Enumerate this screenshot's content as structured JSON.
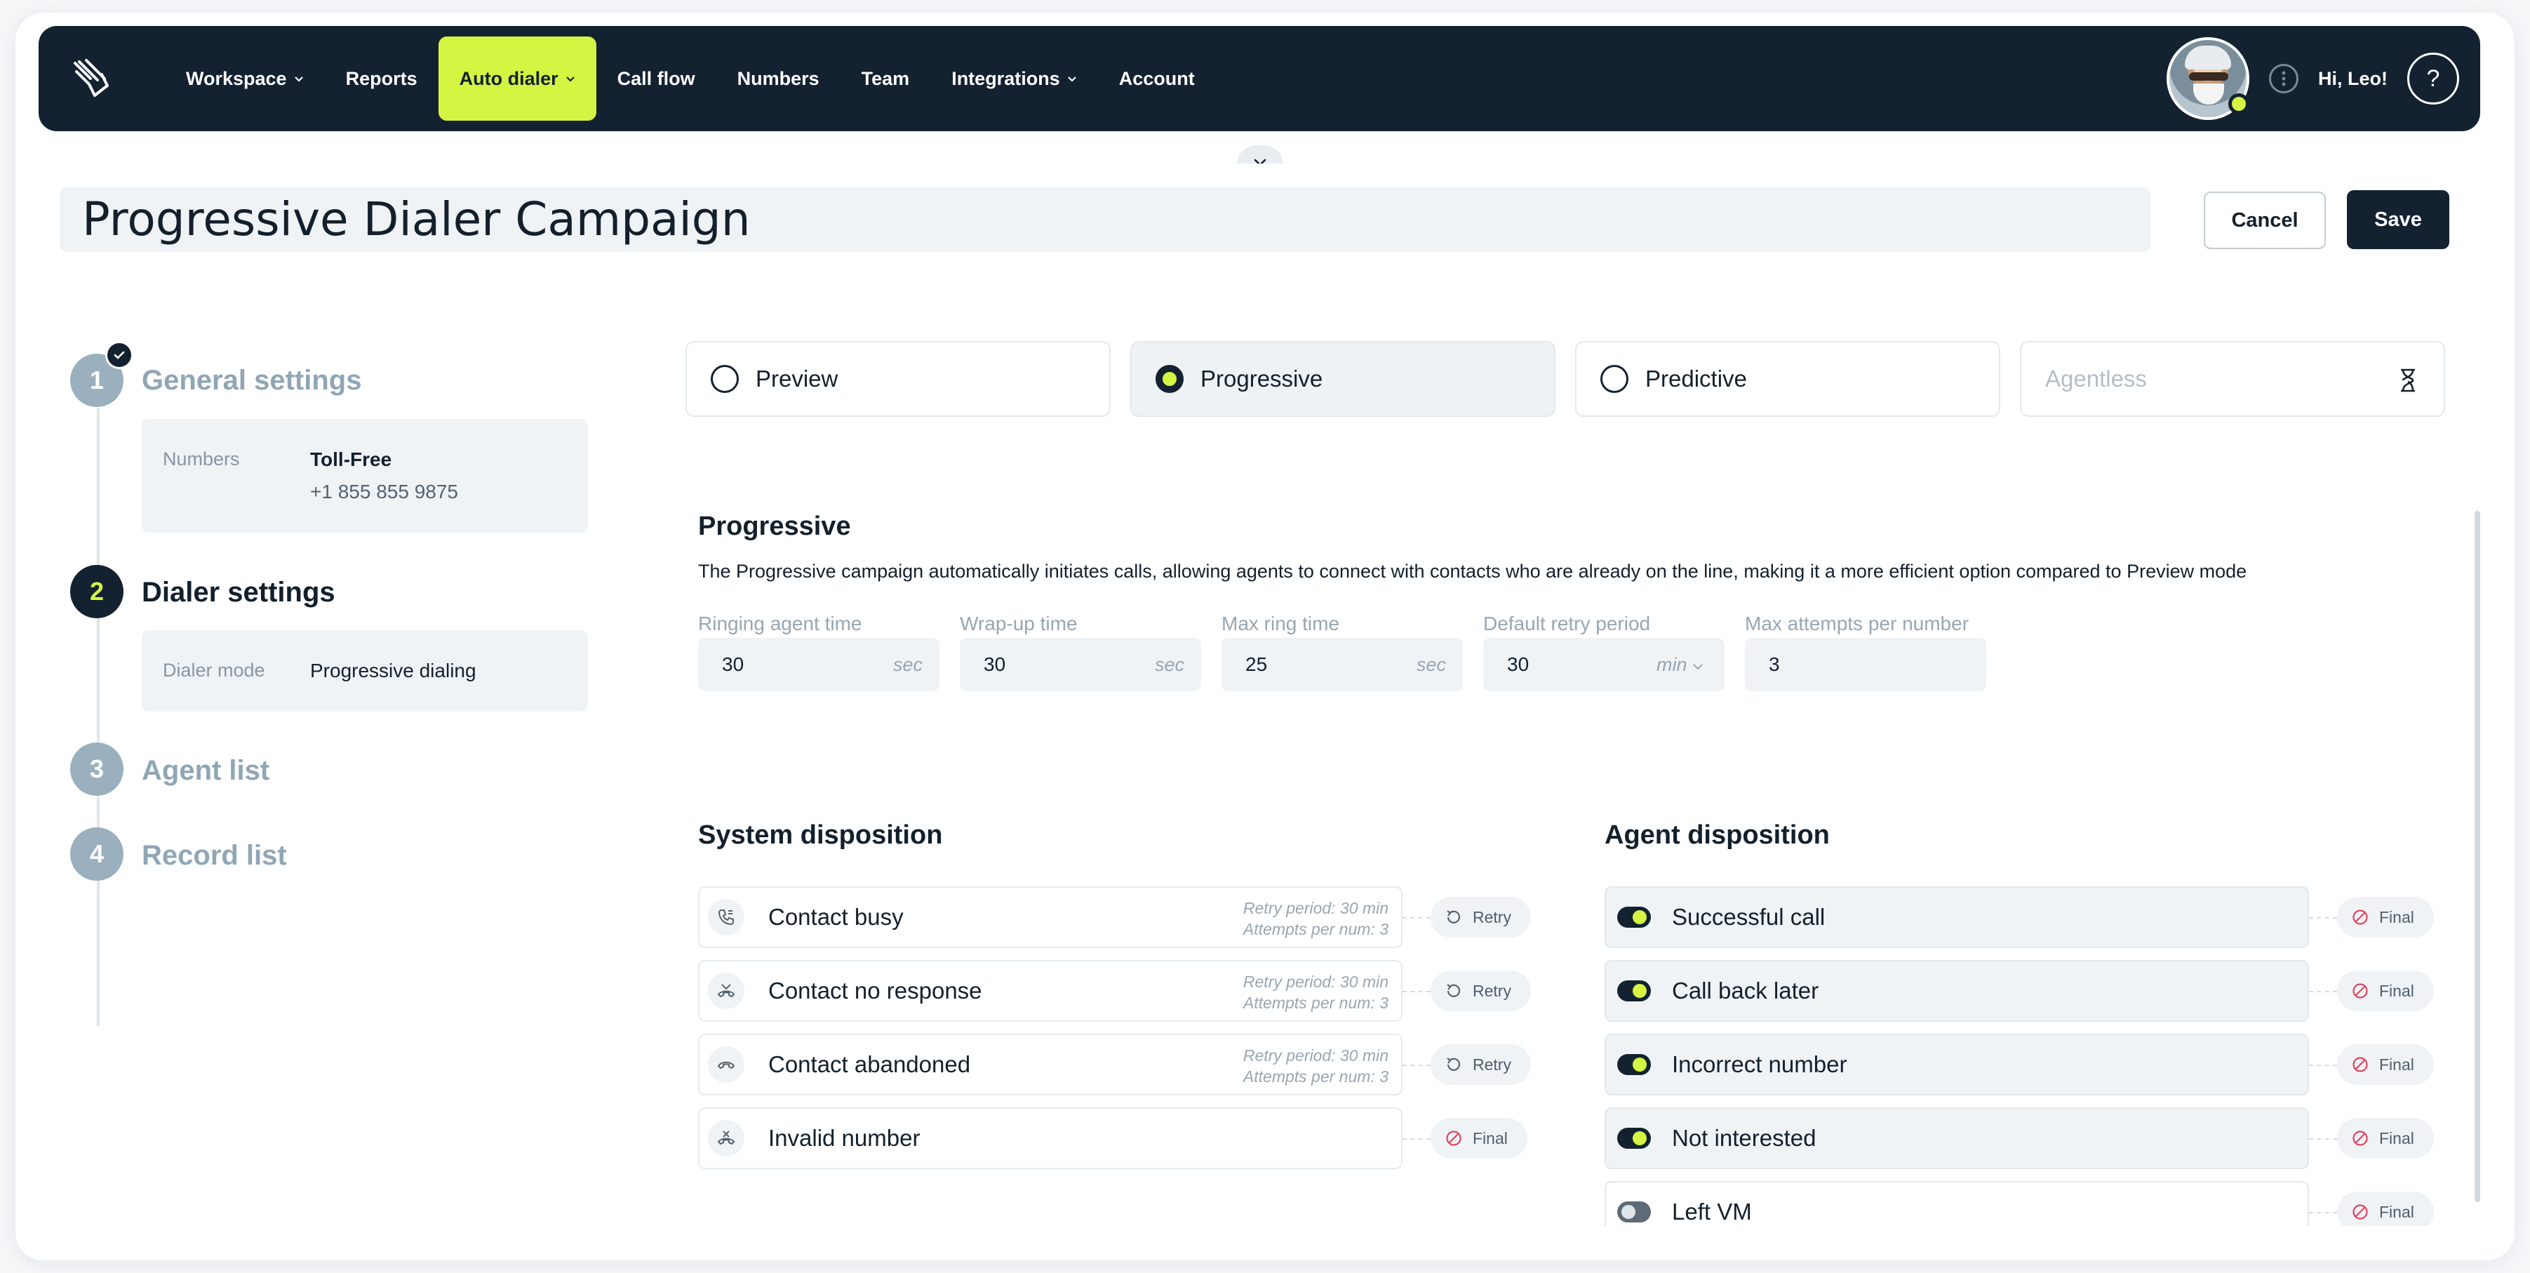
{
  "nav": {
    "items": [
      {
        "label": "Workspace",
        "dropdown": true,
        "active": false
      },
      {
        "label": "Reports",
        "dropdown": false,
        "active": false
      },
      {
        "label": "Auto dialer",
        "dropdown": true,
        "active": true
      },
      {
        "label": "Call flow",
        "dropdown": false,
        "active": false
      },
      {
        "label": "Numbers",
        "dropdown": false,
        "active": false
      },
      {
        "label": "Team",
        "dropdown": false,
        "active": false
      },
      {
        "label": "Integrations",
        "dropdown": true,
        "active": false
      },
      {
        "label": "Account",
        "dropdown": false,
        "active": false
      }
    ],
    "greeting": "Hi, Leo!",
    "help_glyph": "?",
    "accent_color": "#d4f542",
    "nav_bg": "#132130"
  },
  "header": {
    "campaign_title": "Progressive Dialer Campaign",
    "cancel_label": "Cancel",
    "save_label": "Save"
  },
  "steps": [
    {
      "number": "1",
      "title": "General settings",
      "state": "done",
      "details": {
        "label": "Numbers",
        "value_title": "Toll-Free",
        "value": "+1 855 855 9875"
      }
    },
    {
      "number": "2",
      "title": "Dialer settings",
      "state": "current",
      "details": {
        "label": "Dialer mode",
        "value": "Progressive dialing"
      }
    },
    {
      "number": "3",
      "title": "Agent list",
      "state": "todo"
    },
    {
      "number": "4",
      "title": "Record list",
      "state": "todo"
    }
  ],
  "modes": [
    {
      "label": "Preview",
      "selected": false,
      "disabled": false
    },
    {
      "label": "Progressive",
      "selected": true,
      "disabled": false
    },
    {
      "label": "Predictive",
      "selected": false,
      "disabled": false
    },
    {
      "label": "Agentless",
      "selected": false,
      "disabled": true,
      "icon": "hourglass-icon"
    }
  ],
  "progressive": {
    "title": "Progressive",
    "description": "The Progressive campaign automatically initiates calls, allowing agents to connect with contacts who are already on the line, making it a more efficient option compared to Preview mode",
    "fields": [
      {
        "label": "Ringing agent time",
        "value": "30",
        "unit": "sec"
      },
      {
        "label": "Wrap-up time",
        "value": "30",
        "unit": "sec"
      },
      {
        "label": "Max ring time",
        "value": "25",
        "unit": "sec"
      },
      {
        "label": "Default retry period",
        "value": "30",
        "unit": "min"
      },
      {
        "label": "Max attempts per number",
        "value": "3",
        "unit": ""
      }
    ]
  },
  "system_disposition": {
    "title": "System disposition",
    "rows": [
      {
        "name": "Contact busy",
        "icon": "phone-busy-icon",
        "meta1": "Retry period: 30 min",
        "meta2": "Attempts per num: 3",
        "action": "Retry"
      },
      {
        "name": "Contact no response",
        "icon": "phone-no-response-icon",
        "meta1": "Retry period: 30 min",
        "meta2": "Attempts per num: 3",
        "action": "Retry"
      },
      {
        "name": "Contact abandoned",
        "icon": "phone-hangup-icon",
        "meta1": "Retry period: 30 min",
        "meta2": "Attempts per num: 3",
        "action": "Retry"
      },
      {
        "name": "Invalid number",
        "icon": "phone-invalid-icon",
        "meta1": "",
        "meta2": "",
        "action": "Final"
      }
    ]
  },
  "agent_disposition": {
    "title": "Agent disposition",
    "rows": [
      {
        "name": "Successful call",
        "enabled": true,
        "action": "Final"
      },
      {
        "name": "Call back later",
        "enabled": true,
        "action": "Final"
      },
      {
        "name": "Incorrect number",
        "enabled": true,
        "action": "Final"
      },
      {
        "name": "Not interested",
        "enabled": true,
        "action": "Final"
      },
      {
        "name": "Left VM",
        "enabled": false,
        "action": "Final"
      }
    ]
  }
}
